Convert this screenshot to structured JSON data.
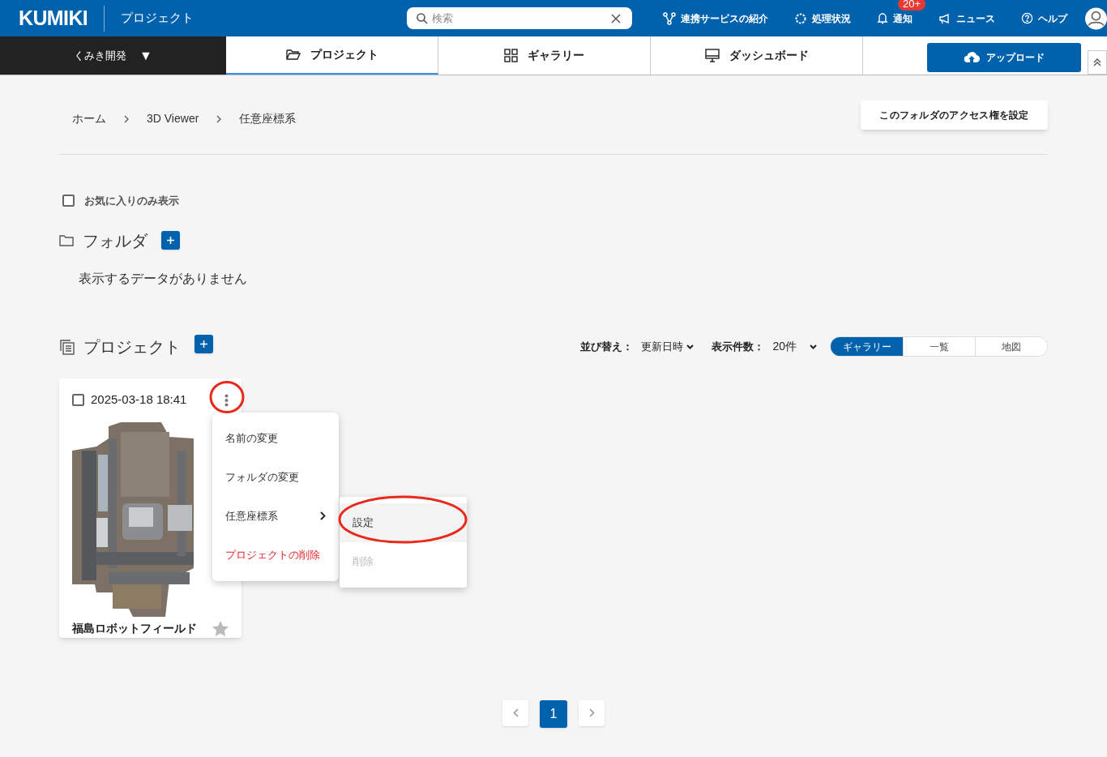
{
  "header": {
    "logo": "KUMIKI",
    "section": "プロジェクト",
    "search": {
      "placeholder": "検索"
    },
    "nav": [
      {
        "kind": "share",
        "label": "連携サービスの紹介"
      },
      {
        "kind": "gear",
        "label": "処理状況"
      },
      {
        "kind": "bell",
        "label": "通知",
        "badge": "20+"
      },
      {
        "kind": "megaphone",
        "label": "ニュース"
      },
      {
        "kind": "help",
        "label": "ヘルプ"
      }
    ]
  },
  "org_switcher": {
    "label": "くみき開発",
    "caret": "▼"
  },
  "tabs": [
    {
      "kind": "folder",
      "label": "プロジェクト",
      "selected": true
    },
    {
      "kind": "grid",
      "label": "ギャラリー",
      "selected": false
    },
    {
      "kind": "monitor",
      "label": "ダッシュボード",
      "selected": false
    }
  ],
  "upload_button": "アップロード",
  "breadcrumb": [
    "ホーム",
    "3D Viewer",
    "任意座標系"
  ],
  "access_button": "このフォルダのアクセス権を設定",
  "favorites_filter": {
    "label": "お気に入りのみ表示",
    "checked": false
  },
  "folders": {
    "title": "フォルダ",
    "empty_text": "表示するデータがありません"
  },
  "projects": {
    "title": "プロジェクト",
    "sort": {
      "label": "並び替え：",
      "value": "更新日時"
    },
    "page_size": {
      "label": "表示件数：",
      "value": "20件"
    },
    "views": [
      {
        "label": "ギャラリー",
        "selected": true
      },
      {
        "label": "一覧",
        "selected": false
      },
      {
        "label": "地図",
        "selected": false
      }
    ],
    "cards": [
      {
        "date": "2025-03-18 18:41",
        "name": "福島ロボットフィールド",
        "checked": false,
        "favorite": false
      }
    ]
  },
  "context_menu": {
    "items": [
      {
        "kind": "action",
        "label": "名前の変更"
      },
      {
        "kind": "action",
        "label": "フォルダの変更"
      },
      {
        "kind": "submenu",
        "label": "任意座標系"
      },
      {
        "kind": "danger",
        "label": "プロジェクトの削除"
      }
    ]
  },
  "submenu": {
    "items": [
      {
        "label": "設定",
        "disabled": false,
        "highlighted": true
      },
      {
        "label": "削除",
        "disabled": true,
        "highlighted": false
      }
    ]
  },
  "pagination": {
    "pages": [
      {
        "label": "1",
        "selected": true
      }
    ]
  }
}
